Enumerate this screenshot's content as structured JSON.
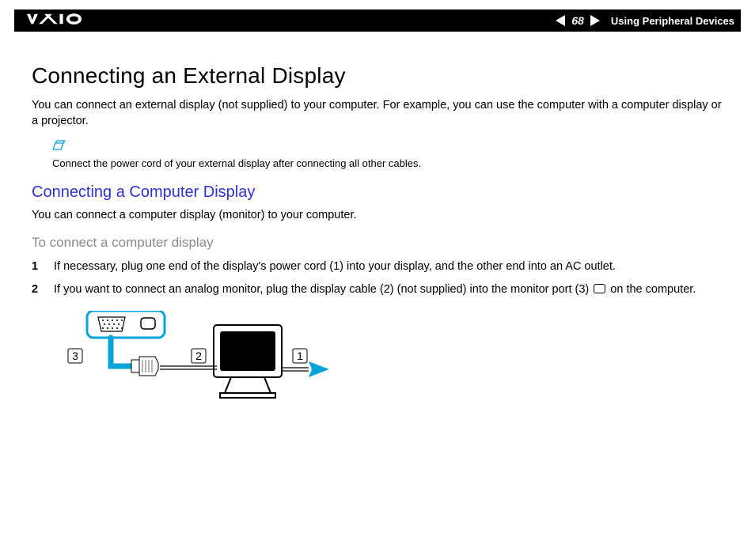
{
  "header": {
    "page_number": "68",
    "section": "Using Peripheral Devices"
  },
  "title": "Connecting an External Display",
  "intro": "You can connect an external display (not supplied) to your computer. For example, you can use the computer with a computer display or a projector.",
  "note": "Connect the power cord of your external display after connecting all other cables.",
  "subhead": "Connecting a Computer Display",
  "sub_intro": "You can connect a computer display (monitor) to your computer.",
  "task_head": "To connect a computer display",
  "steps": {
    "s1": "If necessary, plug one end of the display's power cord (1) into your display, and the other end into an AC outlet.",
    "s2_a": "If you want to connect an analog monitor, plug the display cable (2) (not supplied) into the monitor port (3) ",
    "s2_b": " on the computer."
  },
  "diagram": {
    "labels": {
      "l1": "1",
      "l2": "2",
      "l3": "3"
    }
  }
}
